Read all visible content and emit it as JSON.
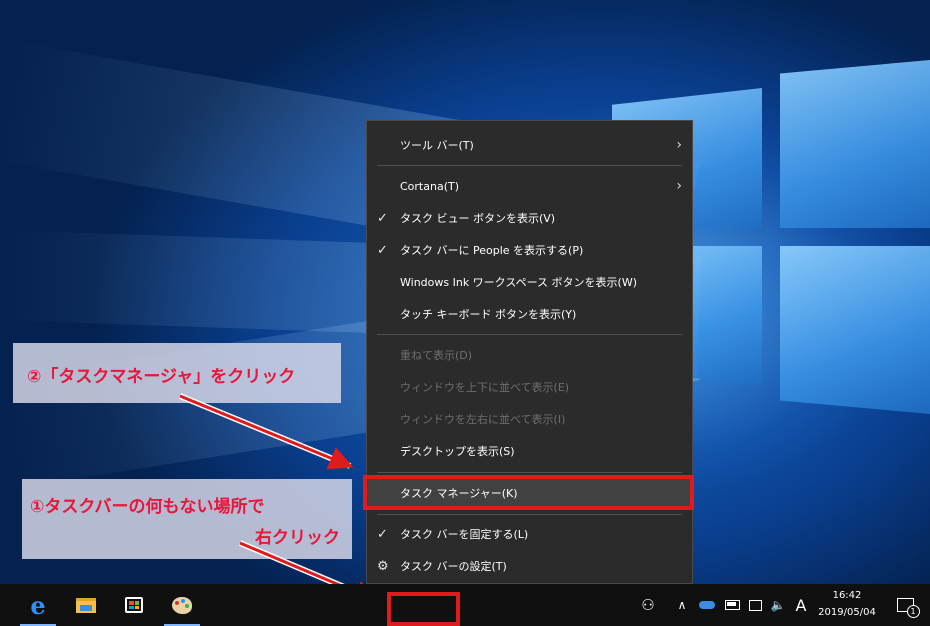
{
  "context_menu": {
    "items": [
      {
        "label": "ツール バー(T)",
        "checked": false,
        "submenu": true,
        "disabled": false
      },
      {
        "label": "Cortana(T)",
        "checked": false,
        "submenu": true,
        "disabled": false
      },
      {
        "label": "タスク ビュー ボタンを表示(V)",
        "checked": true,
        "submenu": false,
        "disabled": false
      },
      {
        "label": "タスク バーに People を表示する(P)",
        "checked": true,
        "submenu": false,
        "disabled": false
      },
      {
        "label": "Windows Ink ワークスペース ボタンを表示(W)",
        "checked": false,
        "submenu": false,
        "disabled": false
      },
      {
        "label": "タッチ キーボード ボタンを表示(Y)",
        "checked": false,
        "submenu": false,
        "disabled": false
      },
      {
        "label": "重ねて表示(D)",
        "checked": false,
        "submenu": false,
        "disabled": true
      },
      {
        "label": "ウィンドウを上下に並べて表示(E)",
        "checked": false,
        "submenu": false,
        "disabled": true
      },
      {
        "label": "ウィンドウを左右に並べて表示(I)",
        "checked": false,
        "submenu": false,
        "disabled": true
      },
      {
        "label": "デスクトップを表示(S)",
        "checked": false,
        "submenu": false,
        "disabled": false
      },
      {
        "label": "タスク マネージャー(K)",
        "checked": false,
        "submenu": false,
        "disabled": false
      },
      {
        "label": "タスク バーを固定する(L)",
        "checked": true,
        "submenu": false,
        "disabled": false
      },
      {
        "label": "タスク バーの設定(T)",
        "checked": false,
        "submenu": false,
        "disabled": false
      }
    ],
    "check_glyph": "✓",
    "arrow_glyph": "›",
    "gear_glyph": "⚙"
  },
  "annotations": {
    "step2": "②「タスクマネージャ」をクリック",
    "step1_line1": "①タスクバーの何もない場所で",
    "step1_line2": "右クリック",
    "highlight_color": "#e01b1b"
  },
  "taskbar": {
    "apps": [
      {
        "name": "edge-icon",
        "glyph": "e",
        "color": "#2f8fff"
      },
      {
        "name": "file-explorer-icon",
        "glyph": "▰",
        "color": "#f2c14e"
      },
      {
        "name": "store-icon",
        "glyph": "▦",
        "color": "#ffffff"
      },
      {
        "name": "paint-icon",
        "glyph": "🎨",
        "color": "#ffffff"
      }
    ],
    "tray": {
      "people_glyph": "⚇",
      "chevron_glyph": "∧",
      "ime": "A",
      "notification_count": "1"
    },
    "clock": {
      "time": "16:42",
      "date": "2019/05/04"
    }
  },
  "colors": {
    "menu_bg": "#2b2b2b",
    "menu_text": "#ffffff",
    "disabled_text": "#6e6e6e",
    "taskbar_bg": "#101010",
    "annotation_text": "#e8163a"
  }
}
